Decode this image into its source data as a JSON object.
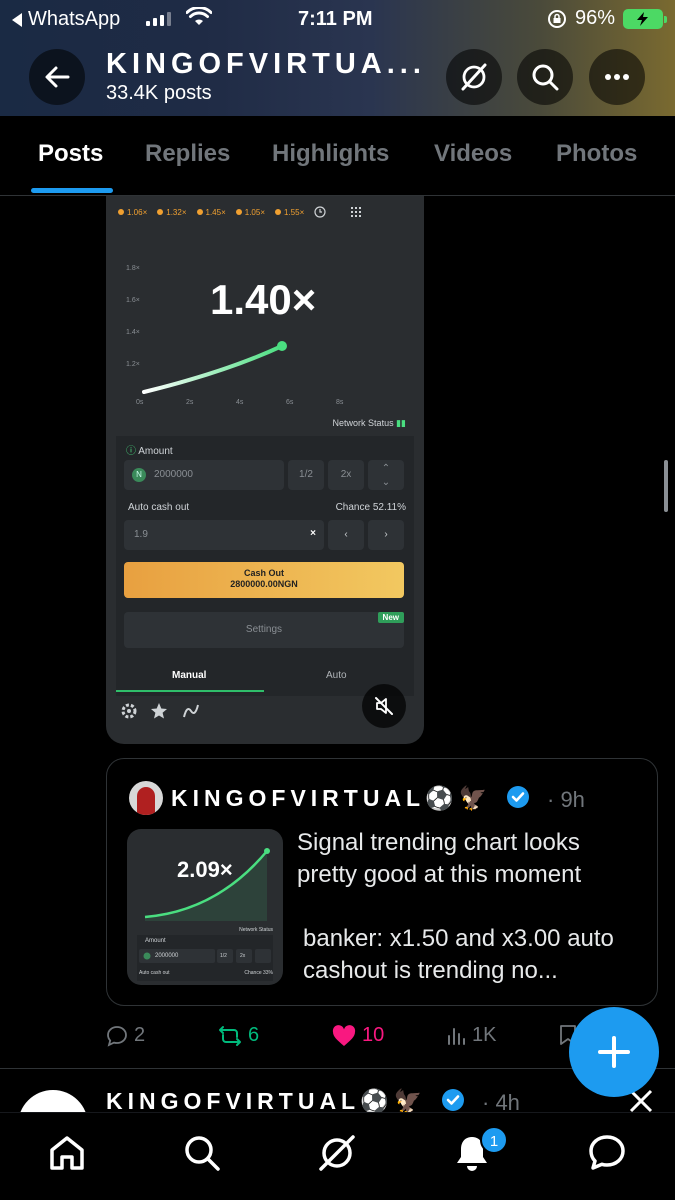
{
  "status_bar": {
    "back_app": "WhatsApp",
    "time": "7:11 PM",
    "battery": "96%"
  },
  "profile": {
    "name": "KINGOFVIRTUA...",
    "post_count": "33.4K posts"
  },
  "tabs": [
    {
      "label": "Posts",
      "active": true
    },
    {
      "label": "Replies",
      "active": false
    },
    {
      "label": "Highlights",
      "active": false
    },
    {
      "label": "Videos",
      "active": false
    },
    {
      "label": "Photos",
      "active": false
    }
  ],
  "media": {
    "multipliers": [
      "1.06×",
      "1.32×",
      "1.45×",
      "1.05×",
      "1.55×"
    ],
    "y_ticks": [
      "1.8×",
      "1.6×",
      "1.4×",
      "1.2×"
    ],
    "x_ticks": [
      "0s",
      "2s",
      "4s",
      "6s",
      "8s"
    ],
    "current_multiplier": "1.40×",
    "network_status": "Network Status",
    "amount_label": "Amount",
    "amount_value": "2000000",
    "half_label": "1/2",
    "double_label": "2x",
    "auto_cashout_label": "Auto cash out",
    "chance_label": "Chance 52.11%",
    "auto_cashout_value": "1.9",
    "clear_label": "×",
    "cash_out_title": "Cash Out",
    "cash_out_amount": "2800000.00NGN",
    "settings_label": "Settings",
    "new_badge": "New",
    "mode_manual": "Manual",
    "mode_auto": "Auto"
  },
  "quote": {
    "name": "KINGOFVIRTUAL⚽🦅",
    "time": "· 9h",
    "text_line1": "Signal trending chart looks pretty good at this moment",
    "text_line2": "banker:   x1.50  and x3.00 auto cashout is trending no...",
    "thumb_multiplier": "2.09×",
    "thumb_amount": "2000000",
    "thumb_half": "1/2",
    "thumb_double": "2x",
    "thumb_amount_label": "Amount",
    "thumb_network": "Network Status",
    "thumb_autocash": "Auto cash out",
    "thumb_chance": "Chance 33%"
  },
  "actions": {
    "replies": "2",
    "reposts": "6",
    "likes": "10",
    "views": "1K"
  },
  "next_post": {
    "name": "KINGOFVIRTUAL⚽🦅",
    "time": "· 4h"
  },
  "nav": {
    "notification_count": "1"
  },
  "colors": {
    "accent": "#1d9bf0",
    "repost_green": "#00ba7c",
    "like_pink": "#f91880",
    "muted_text": "#71767b"
  }
}
